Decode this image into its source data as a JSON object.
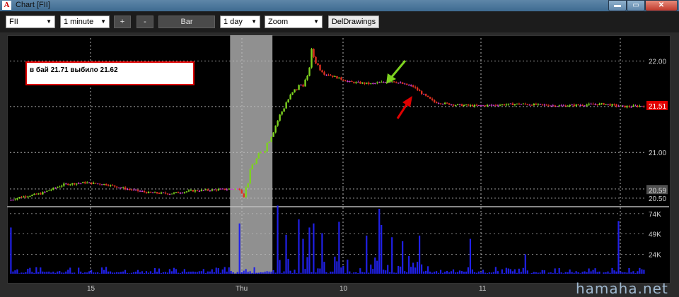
{
  "window": {
    "title": "Chart [FII]",
    "app_icon": "A",
    "min_glyph": "▬",
    "max_glyph": "▭",
    "close_glyph": "✕"
  },
  "toolbar": {
    "symbol": "FII",
    "interval": "1 minute",
    "plus_label": "+",
    "minus_label": "-",
    "bar_label": "Bar",
    "period": "1 day",
    "zoom": "Zoom",
    "del_drawings_label": "DelDrawings"
  },
  "annotation": {
    "text": "в бай 21.71 выбило 21.62",
    "box_color": "#e00000"
  },
  "colors": {
    "up_bar": "#7dd21f",
    "down_bar": "#e03020",
    "flat_bar": "#d040d0",
    "volume": "#2020e8",
    "grid": "#ffffff",
    "shade": "#c0c0c0",
    "last_price_bg": "#e00000",
    "ref_price_bg": "#505050"
  },
  "price_axis": {
    "ticks": [
      "22.00",
      "21.00",
      "20.50"
    ],
    "last_price_label": "21.51",
    "ref_price_label": "20.59"
  },
  "volume_axis": {
    "ticks": [
      "74K",
      "49K",
      "24K"
    ]
  },
  "time_axis": {
    "labels": [
      "15",
      "Thu",
      "10",
      "11"
    ]
  },
  "watermark": "hamaha.net",
  "chart_data": {
    "type": "bar",
    "price_range": [
      20.43,
      22.25
    ],
    "volume_range": [
      0,
      80000
    ],
    "price_path": [
      [
        0,
        20.48
      ],
      [
        4,
        20.51
      ],
      [
        14,
        20.55
      ],
      [
        25,
        20.65
      ],
      [
        35,
        20.67
      ],
      [
        45,
        20.65
      ],
      [
        55,
        20.6
      ],
      [
        65,
        20.56
      ],
      [
        75,
        20.55
      ],
      [
        85,
        20.58
      ],
      [
        95,
        20.59
      ],
      [
        103,
        20.6
      ],
      [
        108,
        20.6
      ],
      [
        110,
        20.52
      ],
      [
        114,
        20.86
      ],
      [
        120,
        21.05
      ],
      [
        125,
        21.3
      ],
      [
        130,
        21.55
      ],
      [
        135,
        21.7
      ],
      [
        140,
        21.8
      ],
      [
        142,
        22.1
      ],
      [
        145,
        21.95
      ],
      [
        150,
        21.85
      ],
      [
        160,
        21.77
      ],
      [
        170,
        21.75
      ],
      [
        180,
        21.78
      ],
      [
        190,
        21.72
      ],
      [
        195,
        21.63
      ],
      [
        200,
        21.55
      ],
      [
        210,
        21.52
      ],
      [
        220,
        21.51
      ],
      [
        240,
        21.53
      ],
      [
        260,
        21.51
      ],
      [
        280,
        21.53
      ],
      [
        290,
        21.5
      ],
      [
        299,
        21.51
      ]
    ],
    "volume_spikes": [
      [
        0,
        57000
      ],
      [
        108,
        62000
      ],
      [
        126,
        84000
      ],
      [
        130,
        48000
      ],
      [
        136,
        67000
      ],
      [
        138,
        43000
      ],
      [
        141,
        57000
      ],
      [
        143,
        62000
      ],
      [
        147,
        50000
      ],
      [
        155,
        64000
      ],
      [
        168,
        47000
      ],
      [
        174,
        80000
      ],
      [
        175,
        60000
      ],
      [
        180,
        45000
      ],
      [
        185,
        40000
      ],
      [
        193,
        47000
      ],
      [
        217,
        43000
      ],
      [
        243,
        24000
      ],
      [
        287,
        65000
      ]
    ],
    "shaded_region_bars": [
      104,
      124
    ],
    "last_price": 21.51,
    "reference_price": 20.59
  }
}
